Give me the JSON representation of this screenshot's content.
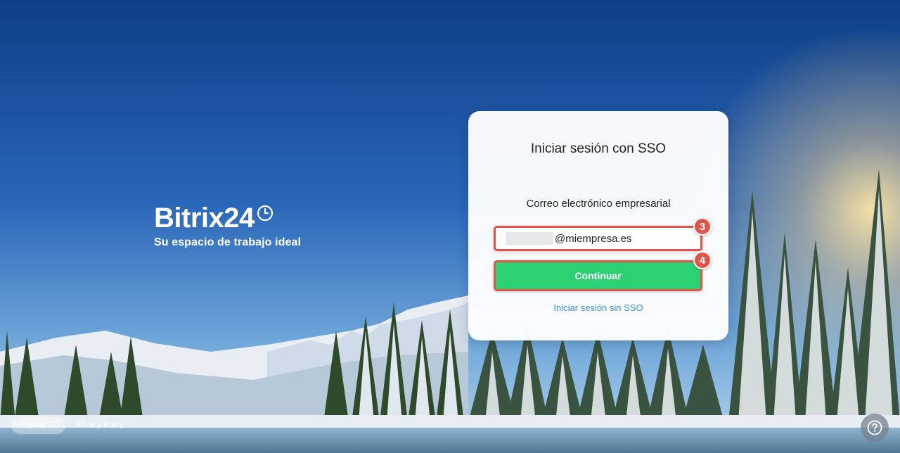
{
  "brand": {
    "logo_text": "Bitrix24",
    "slogan": "Su espacio de trabajo ideal"
  },
  "login_card": {
    "title": "Iniciar sesión con SSO",
    "email_label": "Correo electrónico empresarial",
    "email_value_domain": "@miempresa.es",
    "continue_label": "Continuar",
    "no_sso_link": "Iniciar sesión sin SSO",
    "annotation_badges": [
      "3",
      "4"
    ]
  },
  "footer": {
    "language": "Español",
    "privacy_link": "Privacy Policy"
  },
  "colors": {
    "accent_green": "#2bd173",
    "annotation_red": "#e0554a",
    "link_blue": "#3b8fd0"
  },
  "icons": {
    "brand_clock": "clock-icon",
    "language_chevron": "chevron-down-icon",
    "help": "question-icon"
  }
}
